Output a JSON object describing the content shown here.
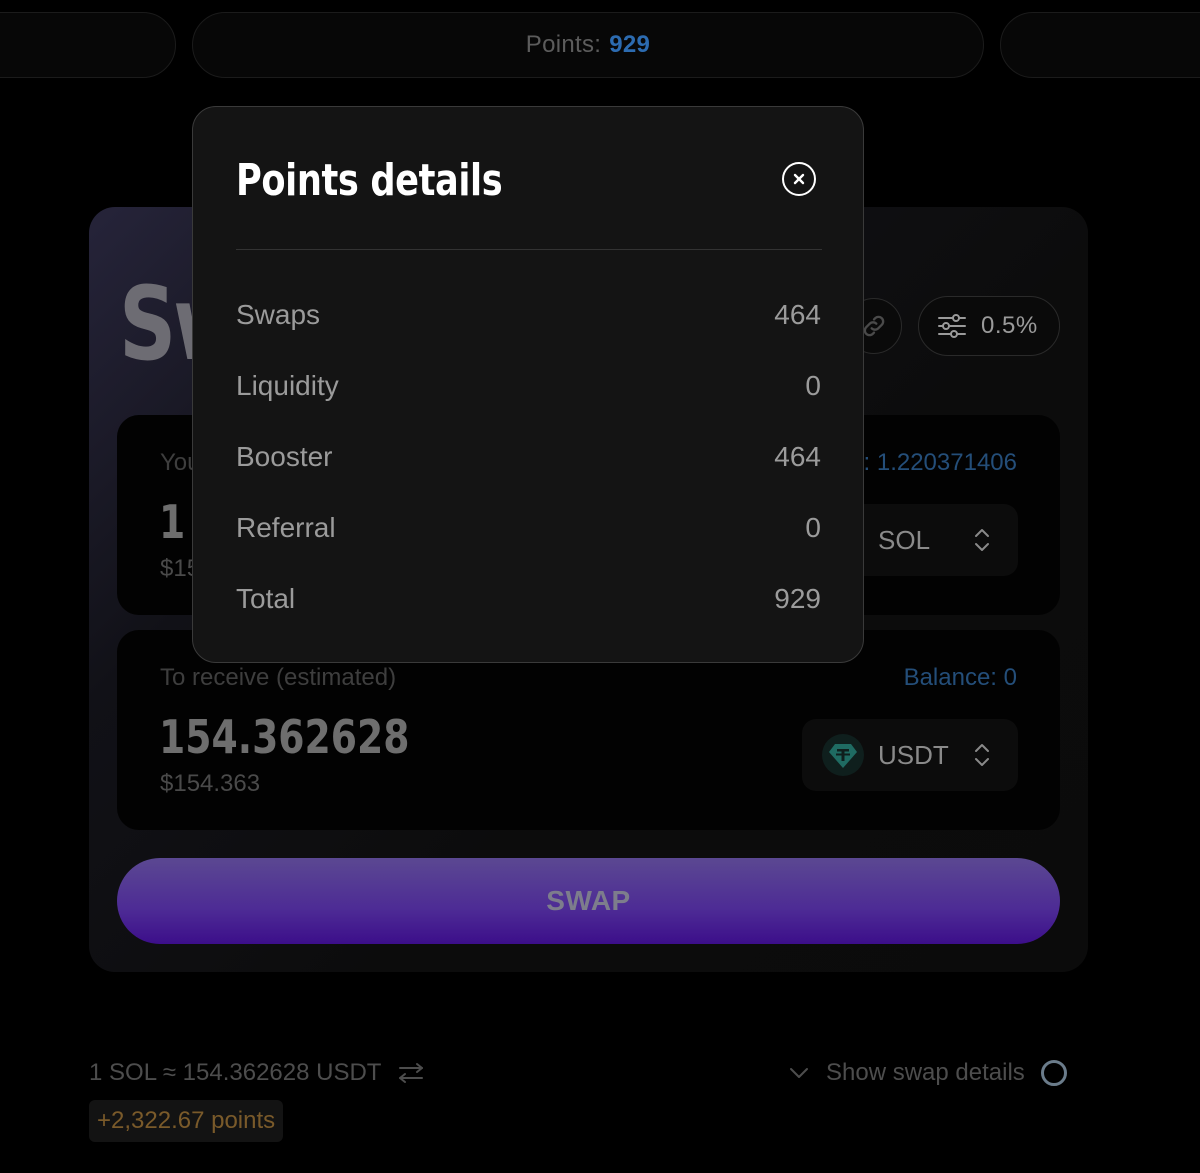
{
  "header": {
    "points_label": "Points:",
    "points_value": "929"
  },
  "swap": {
    "title": "Swap",
    "slippage": "0.5%",
    "pay": {
      "label": "You pay",
      "balance": "Balance: 1.220371406",
      "amount": "1",
      "usd": "$154.36",
      "token": "SOL"
    },
    "receive": {
      "label": "To receive (estimated)",
      "balance": "Balance: 0",
      "amount": "154.362628",
      "usd": "$154.363",
      "token": "USDT"
    },
    "button_label": "SWAP"
  },
  "footer": {
    "rate": "1 SOL ≈ 154.362628 USDT",
    "points_earned": "+2,322.67 points",
    "details_toggle": "Show swap details"
  },
  "modal": {
    "title": "Points details",
    "rows": [
      {
        "label": "Swaps",
        "value": "464"
      },
      {
        "label": "Liquidity",
        "value": "0"
      },
      {
        "label": "Booster",
        "value": "464"
      },
      {
        "label": "Referral",
        "value": "0"
      },
      {
        "label": "Total",
        "value": "929"
      }
    ]
  },
  "colors": {
    "accent_blue": "#2c6bb0",
    "swap_purple": "#4d2b95",
    "points_orange": "#7a5a2a"
  }
}
